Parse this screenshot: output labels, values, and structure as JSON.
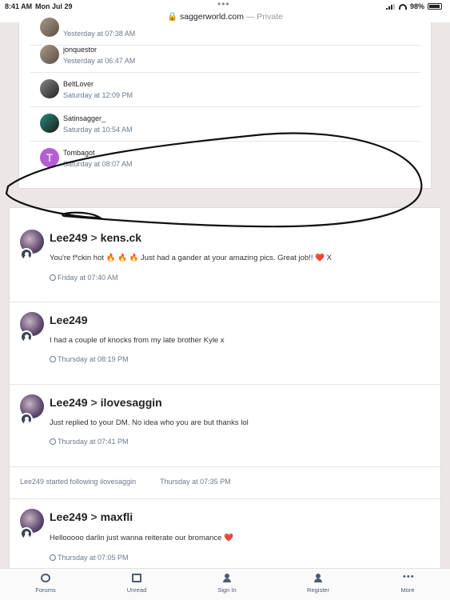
{
  "status_bar": {
    "time": "8:41 AM",
    "date": "Mon Jul 29",
    "url": "saggerworld.com",
    "private_label": "— Private",
    "battery": "98%",
    "battery_level": 0.98
  },
  "followers": [
    {
      "name": "",
      "time": "Yesterday at 07:38 AM",
      "avatar": "photo"
    },
    {
      "name": "jonquestor",
      "time": "Yesterday at 06:47 AM",
      "avatar": "photo"
    },
    {
      "name": "BeltLover",
      "time": "Saturday at 12:09 PM",
      "avatar": "photo"
    },
    {
      "name": "Satinsagger_",
      "time": "Saturday at 10:54 AM",
      "avatar": "photo"
    },
    {
      "name": "Tombagot",
      "time": "Saturday at 08:07 AM",
      "avatar": "letter",
      "letter": "T"
    }
  ],
  "feed": {
    "posts": [
      {
        "author": "Lee249",
        "target": "kens.ck",
        "text_before": "You're f*ckin hot ",
        "emojis_mid": "🔥 🔥 🔥",
        "text_after": " Just had a gander at your amazing pics. Great job!! ",
        "trailing_emoji": "❤️",
        "trailing_text": " X",
        "time": "Friday at 07:40 AM"
      },
      {
        "author": "Lee249",
        "target": "",
        "text": "I had a couple of knocks from my late brother Kyle x",
        "time": "Thursday at 08:19 PM"
      },
      {
        "author": "Lee249",
        "target": "ilovesaggin",
        "text": "Just replied to your DM. No idea who you are but thanks lol",
        "time": "Thursday at 07:41 PM"
      },
      {
        "author": "Lee249",
        "target": "maxfli",
        "text": "Hellooooo darlin just wanna reiterate our bromance ",
        "trailing_emoji": "❤️",
        "time": "Thursday at 07:05 PM"
      }
    ],
    "activity": {
      "text": "Lee249 started following ilovesaggin",
      "time": "Thursday at 07:35 PM"
    },
    "arrow_symbol": ">"
  },
  "bottom_nav": [
    {
      "label": "Forums",
      "icon": "forums-icon"
    },
    {
      "label": "Unread",
      "icon": "unread-icon"
    },
    {
      "label": "Sign In",
      "icon": "user-icon"
    },
    {
      "label": "Register",
      "icon": "user-icon"
    },
    {
      "label": "More",
      "icon": "more-icon"
    }
  ],
  "colors": {
    "accent_text": "#6c7a8a",
    "nav": "#4b5b73",
    "letter_avatar": "#b35ed3"
  }
}
